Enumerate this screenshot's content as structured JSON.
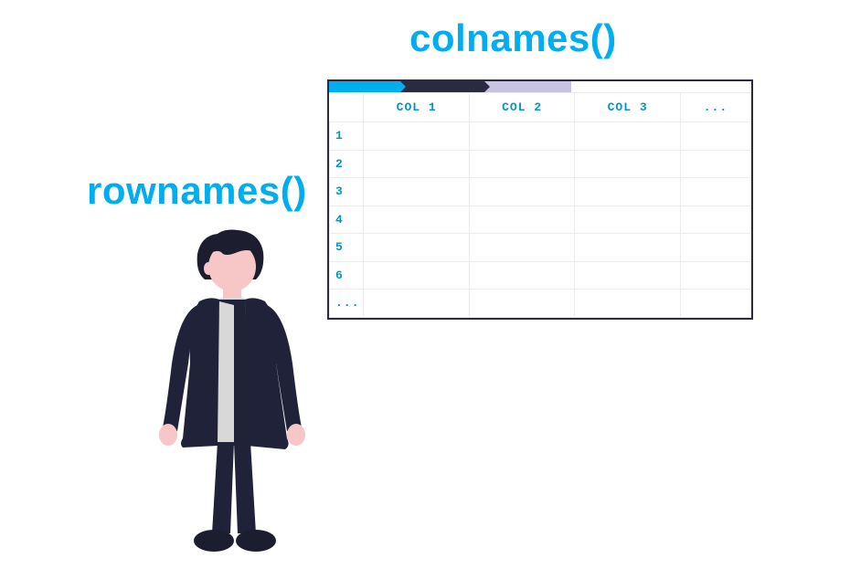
{
  "labels": {
    "colnames": "colnames()",
    "rownames": "rownames()"
  },
  "table": {
    "columns": [
      "COL 1",
      "COL 2",
      "COL 3",
      "..."
    ],
    "rows": [
      "1",
      "2",
      "3",
      "4",
      "5",
      "6",
      "..."
    ]
  },
  "colors": {
    "accent": "#00aeef",
    "dark": "#2a2b40",
    "light_purple": "#c7c3e0",
    "skin": "#f7c6c6",
    "shirt": "#d8d8d8"
  }
}
